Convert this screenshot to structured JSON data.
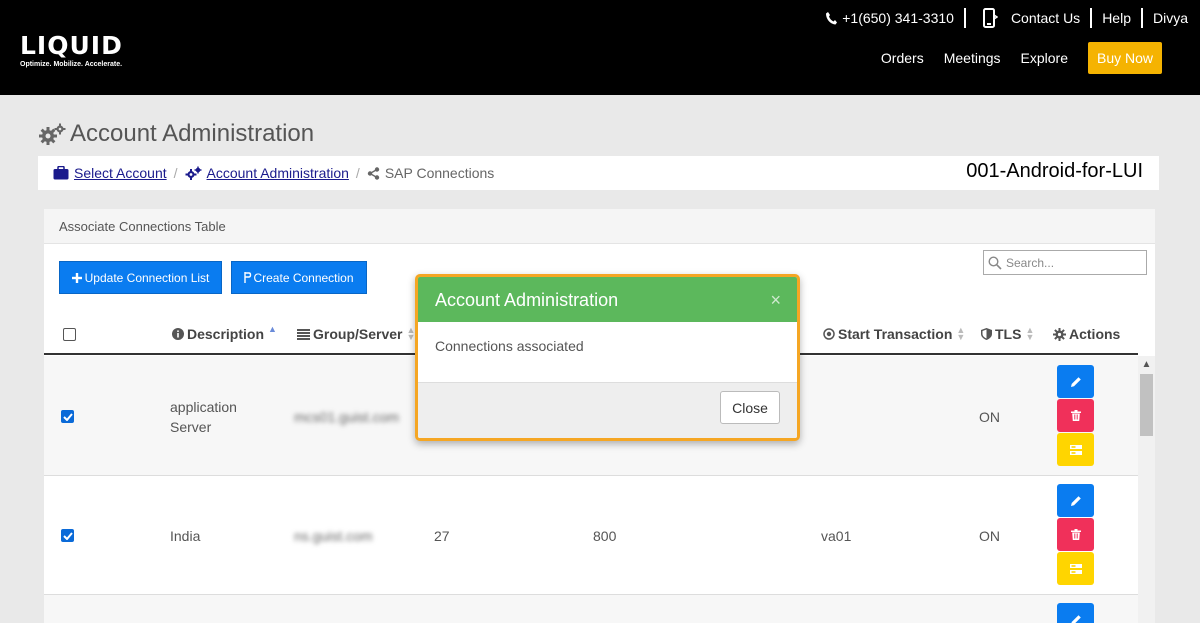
{
  "header": {
    "logo_text": "LIQUID",
    "logo_tagline": "Optimize. Mobilize. Accelerate.",
    "phone": "+1(650) 341-3310",
    "contact_label": "Contact Us",
    "help_label": "Help",
    "user_name": "Divya",
    "nav": [
      "Orders",
      "Meetings",
      "Explore"
    ],
    "buy_label": "Buy Now"
  },
  "page": {
    "title": "Account Administration"
  },
  "breadcrumb": {
    "items": [
      "Select Account",
      "Account Administration"
    ],
    "current": "SAP Connections",
    "account": "001-Android-for-LUI"
  },
  "panel": {
    "title": "Associate Connections Table",
    "update_btn": "Update Connection List",
    "create_btn": "Create Connection",
    "search_placeholder": "Search..."
  },
  "table": {
    "headers": {
      "description": "Description",
      "group_server": "Group/Server",
      "start_transaction": "Start Transaction",
      "tls": "TLS",
      "actions": "Actions"
    },
    "rows": [
      {
        "description": "application Server",
        "server": "mcs01.guist.com",
        "instance": "",
        "client": "",
        "start_tx": "",
        "tls": "ON"
      },
      {
        "description": "India",
        "server": "ns.guist.com",
        "instance": "27",
        "client": "800",
        "start_tx": "va01",
        "tls": "ON"
      }
    ]
  },
  "modal": {
    "title": "Account Administration",
    "message": "Connections associated",
    "close_label": "Close",
    "close_x": "×"
  },
  "colors": {
    "brand_yellow": "#f5b301",
    "primary_blue": "#0a7cf0",
    "danger_red": "#f0305a",
    "warning_yellow": "#ffd500",
    "success_green": "#5cb85c",
    "modal_border": "#f5a623"
  }
}
